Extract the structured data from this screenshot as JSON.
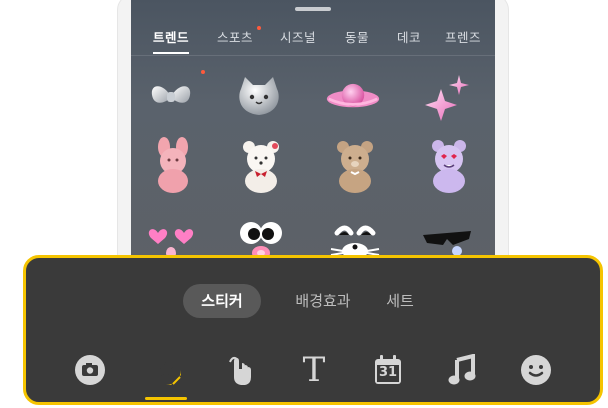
{
  "sticker_panel": {
    "tabs": [
      {
        "label": "트렌드",
        "active": true
      },
      {
        "label": "스포츠",
        "badge": true
      },
      {
        "label": "시즈널"
      },
      {
        "label": "동물"
      },
      {
        "label": "데코"
      },
      {
        "label": "프렌즈"
      }
    ],
    "stickers": [
      "bow-sticker-icon",
      "silver-cat-sticker-icon",
      "pink-planet-sticker-icon",
      "sparkle-stars-sticker-icon",
      "pink-fluffy-bunny-sticker-icon",
      "white-bear-sticker-icon",
      "brown-bear-sticker-icon",
      "purple-fluffy-monster-sticker-icon",
      "heart-eyes-face-sticker-icon",
      "googly-eyes-face-sticker-icon",
      "cat-whiskers-face-sticker-icon",
      "sunglasses-face-sticker-icon"
    ]
  },
  "toolbar": {
    "tabs": [
      {
        "label": "스티커",
        "active": true
      },
      {
        "label": "배경효과"
      },
      {
        "label": "세트"
      }
    ],
    "tools": [
      "camera-icon",
      "sticker-star-icon",
      "tap-hand-icon",
      "text-T-icon",
      "calendar-icon",
      "music-note-icon",
      "smiley-icon"
    ],
    "calendar_number": "31",
    "text_tool_glyph": "T"
  },
  "colors": {
    "accent": "#f5c400",
    "toolbar_bg": "#3a3a3a",
    "panel_bg": "#55606a"
  }
}
